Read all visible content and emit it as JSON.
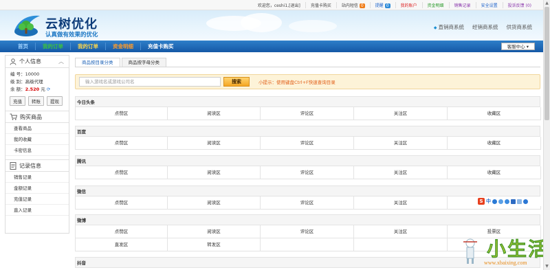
{
  "topbar": {
    "welcome": "欢迎您，ceshi1,[退出]",
    "charge_buy": "充值卡购买",
    "messages": "站内短信",
    "messages_count": "0",
    "tickets": "提醒",
    "tickets_count": "0",
    "my_account": "我的账户",
    "funds": "资金明细",
    "sales_records": "销售记录",
    "security": "安全设置",
    "complaint": "投诉反馈 (0)"
  },
  "header": {
    "title": "云树优化",
    "slogan": "认真做有效果的优化",
    "systems": [
      "直销商系统",
      "经销商系统",
      "供货商系统"
    ]
  },
  "menubar": {
    "items": [
      "首页",
      "我的订单",
      "我的订单",
      "资金明细",
      "充值卡购买"
    ],
    "customer_service": "客服中心 ▾"
  },
  "sidebar": {
    "personal": {
      "title": "个人信息",
      "id_label": "编  号：",
      "id": "10000",
      "level_label": "级  别：",
      "level": "高级代理",
      "balance_label": "余  额：",
      "balance": "2.520",
      "balance_unit": "元",
      "buttons": [
        "充值",
        "转账",
        "提现"
      ]
    },
    "buy": {
      "title": "购买商品",
      "items": [
        "查看商品",
        "我的收藏",
        "卡密信息"
      ]
    },
    "records": {
      "title": "记录信息",
      "items": [
        "销售记录",
        "金额记录",
        "充值记录",
        "直入记录"
      ]
    }
  },
  "tabs": [
    "商品按目录分类",
    "商品按字母分类"
  ],
  "search": {
    "placeholder": "输入游戏名或游戏公司名",
    "button": "搜索",
    "tip": "小提示：使用键盘Ctrl+F快速查询目录"
  },
  "categories": [
    {
      "name": "今日头条",
      "rows": [
        [
          "点赞区",
          "阅读区",
          "评论区",
          "关注区",
          "收藏区"
        ]
      ]
    },
    {
      "name": "百度",
      "rows": [
        [
          "点赞区",
          "阅读区",
          "评论区",
          "关注区",
          "收藏区"
        ]
      ]
    },
    {
      "name": "腾讯",
      "rows": [
        [
          "点赞区",
          "阅读区",
          "评论区",
          "关注区",
          "收藏区"
        ]
      ]
    },
    {
      "name": "微信",
      "rows": [
        [
          "点赞区",
          "阅读区",
          "评论区",
          "关注区",
          ""
        ]
      ]
    },
    {
      "name": "微博",
      "rows": [
        [
          "点赞区",
          "阅读区",
          "评论区",
          "关注区",
          "投票区"
        ],
        [
          "直发区",
          "转发区",
          "",
          "",
          ""
        ]
      ]
    },
    {
      "name": "抖音",
      "rows": []
    }
  ],
  "ime": {
    "label": "中"
  },
  "watermark": {
    "text": "小生活",
    "url": "www.xbaixing.com"
  },
  "colors": {
    "menubar": "#1b64b4",
    "accent_orange": "#f5a623",
    "money": "#d60000",
    "link_blue": "#1d62b7"
  }
}
